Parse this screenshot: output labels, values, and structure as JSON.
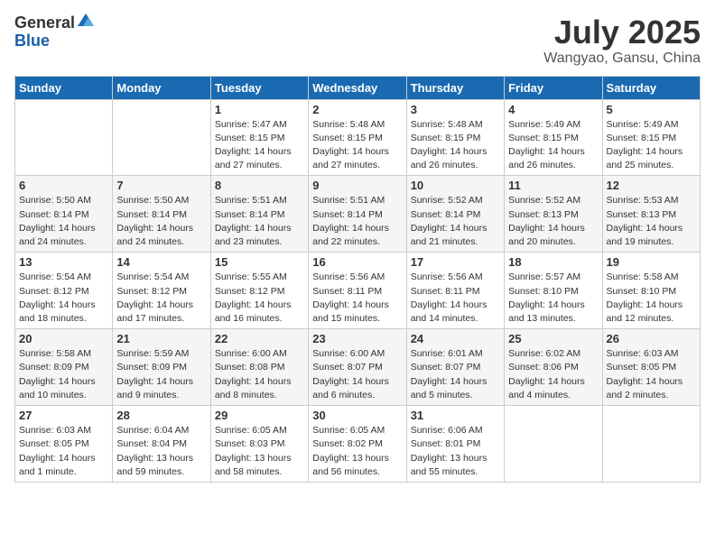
{
  "header": {
    "logo_general": "General",
    "logo_blue": "Blue",
    "month": "July 2025",
    "location": "Wangyao, Gansu, China"
  },
  "weekdays": [
    "Sunday",
    "Monday",
    "Tuesday",
    "Wednesday",
    "Thursday",
    "Friday",
    "Saturday"
  ],
  "weeks": [
    [
      {
        "num": "",
        "info": ""
      },
      {
        "num": "",
        "info": ""
      },
      {
        "num": "1",
        "info": "Sunrise: 5:47 AM\nSunset: 8:15 PM\nDaylight: 14 hours\nand 27 minutes."
      },
      {
        "num": "2",
        "info": "Sunrise: 5:48 AM\nSunset: 8:15 PM\nDaylight: 14 hours\nand 27 minutes."
      },
      {
        "num": "3",
        "info": "Sunrise: 5:48 AM\nSunset: 8:15 PM\nDaylight: 14 hours\nand 26 minutes."
      },
      {
        "num": "4",
        "info": "Sunrise: 5:49 AM\nSunset: 8:15 PM\nDaylight: 14 hours\nand 26 minutes."
      },
      {
        "num": "5",
        "info": "Sunrise: 5:49 AM\nSunset: 8:15 PM\nDaylight: 14 hours\nand 25 minutes."
      }
    ],
    [
      {
        "num": "6",
        "info": "Sunrise: 5:50 AM\nSunset: 8:14 PM\nDaylight: 14 hours\nand 24 minutes."
      },
      {
        "num": "7",
        "info": "Sunrise: 5:50 AM\nSunset: 8:14 PM\nDaylight: 14 hours\nand 24 minutes."
      },
      {
        "num": "8",
        "info": "Sunrise: 5:51 AM\nSunset: 8:14 PM\nDaylight: 14 hours\nand 23 minutes."
      },
      {
        "num": "9",
        "info": "Sunrise: 5:51 AM\nSunset: 8:14 PM\nDaylight: 14 hours\nand 22 minutes."
      },
      {
        "num": "10",
        "info": "Sunrise: 5:52 AM\nSunset: 8:14 PM\nDaylight: 14 hours\nand 21 minutes."
      },
      {
        "num": "11",
        "info": "Sunrise: 5:52 AM\nSunset: 8:13 PM\nDaylight: 14 hours\nand 20 minutes."
      },
      {
        "num": "12",
        "info": "Sunrise: 5:53 AM\nSunset: 8:13 PM\nDaylight: 14 hours\nand 19 minutes."
      }
    ],
    [
      {
        "num": "13",
        "info": "Sunrise: 5:54 AM\nSunset: 8:12 PM\nDaylight: 14 hours\nand 18 minutes."
      },
      {
        "num": "14",
        "info": "Sunrise: 5:54 AM\nSunset: 8:12 PM\nDaylight: 14 hours\nand 17 minutes."
      },
      {
        "num": "15",
        "info": "Sunrise: 5:55 AM\nSunset: 8:12 PM\nDaylight: 14 hours\nand 16 minutes."
      },
      {
        "num": "16",
        "info": "Sunrise: 5:56 AM\nSunset: 8:11 PM\nDaylight: 14 hours\nand 15 minutes."
      },
      {
        "num": "17",
        "info": "Sunrise: 5:56 AM\nSunset: 8:11 PM\nDaylight: 14 hours\nand 14 minutes."
      },
      {
        "num": "18",
        "info": "Sunrise: 5:57 AM\nSunset: 8:10 PM\nDaylight: 14 hours\nand 13 minutes."
      },
      {
        "num": "19",
        "info": "Sunrise: 5:58 AM\nSunset: 8:10 PM\nDaylight: 14 hours\nand 12 minutes."
      }
    ],
    [
      {
        "num": "20",
        "info": "Sunrise: 5:58 AM\nSunset: 8:09 PM\nDaylight: 14 hours\nand 10 minutes."
      },
      {
        "num": "21",
        "info": "Sunrise: 5:59 AM\nSunset: 8:09 PM\nDaylight: 14 hours\nand 9 minutes."
      },
      {
        "num": "22",
        "info": "Sunrise: 6:00 AM\nSunset: 8:08 PM\nDaylight: 14 hours\nand 8 minutes."
      },
      {
        "num": "23",
        "info": "Sunrise: 6:00 AM\nSunset: 8:07 PM\nDaylight: 14 hours\nand 6 minutes."
      },
      {
        "num": "24",
        "info": "Sunrise: 6:01 AM\nSunset: 8:07 PM\nDaylight: 14 hours\nand 5 minutes."
      },
      {
        "num": "25",
        "info": "Sunrise: 6:02 AM\nSunset: 8:06 PM\nDaylight: 14 hours\nand 4 minutes."
      },
      {
        "num": "26",
        "info": "Sunrise: 6:03 AM\nSunset: 8:05 PM\nDaylight: 14 hours\nand 2 minutes."
      }
    ],
    [
      {
        "num": "27",
        "info": "Sunrise: 6:03 AM\nSunset: 8:05 PM\nDaylight: 14 hours\nand 1 minute."
      },
      {
        "num": "28",
        "info": "Sunrise: 6:04 AM\nSunset: 8:04 PM\nDaylight: 13 hours\nand 59 minutes."
      },
      {
        "num": "29",
        "info": "Sunrise: 6:05 AM\nSunset: 8:03 PM\nDaylight: 13 hours\nand 58 minutes."
      },
      {
        "num": "30",
        "info": "Sunrise: 6:05 AM\nSunset: 8:02 PM\nDaylight: 13 hours\nand 56 minutes."
      },
      {
        "num": "31",
        "info": "Sunrise: 6:06 AM\nSunset: 8:01 PM\nDaylight: 13 hours\nand 55 minutes."
      },
      {
        "num": "",
        "info": ""
      },
      {
        "num": "",
        "info": ""
      }
    ]
  ]
}
